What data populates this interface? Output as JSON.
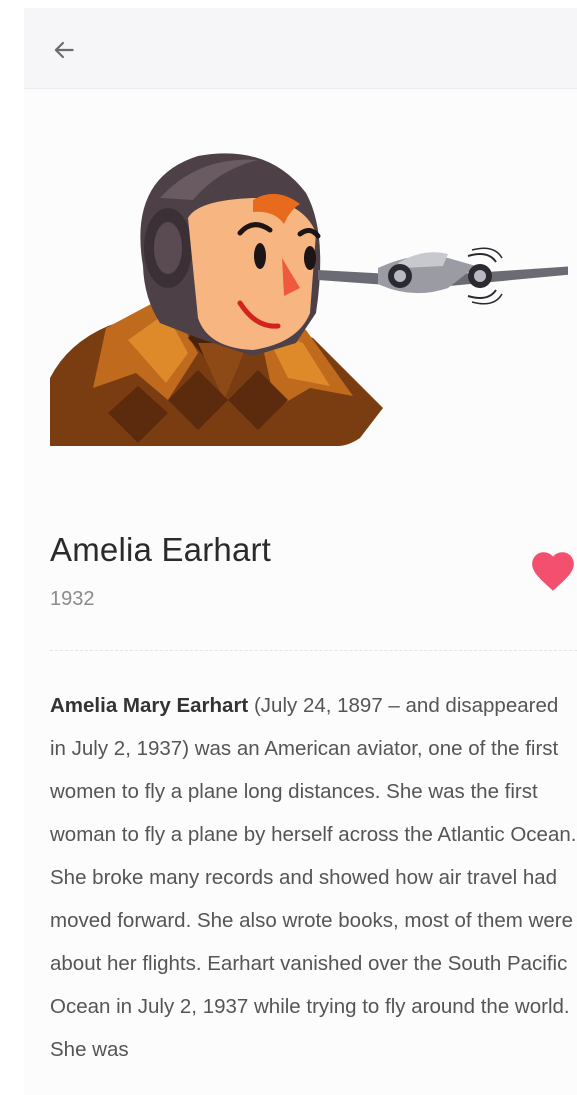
{
  "header": {
    "back_icon": "arrow-left-icon"
  },
  "hero": {
    "illustration": "aviator-with-plane-illustration"
  },
  "profile": {
    "name": "Amelia Earhart",
    "year": "1932",
    "favorite_icon": "heart-icon",
    "favorite_color": "#f2506e",
    "favorited": true
  },
  "bio": {
    "lead": "Amelia Mary Earhart",
    "text": " (July 24, 1897 – and disappeared in July 2, 1937) was an American aviator, one of the first women to fly a plane long distances. She was the first woman to fly a plane by herself across the Atlantic Ocean. She broke many records and showed how air travel had moved forward. She also wrote books, most of them were about her flights. Earhart vanished over the South Pacific Ocean in July 2, 1937 while trying to fly around the world. She was"
  }
}
